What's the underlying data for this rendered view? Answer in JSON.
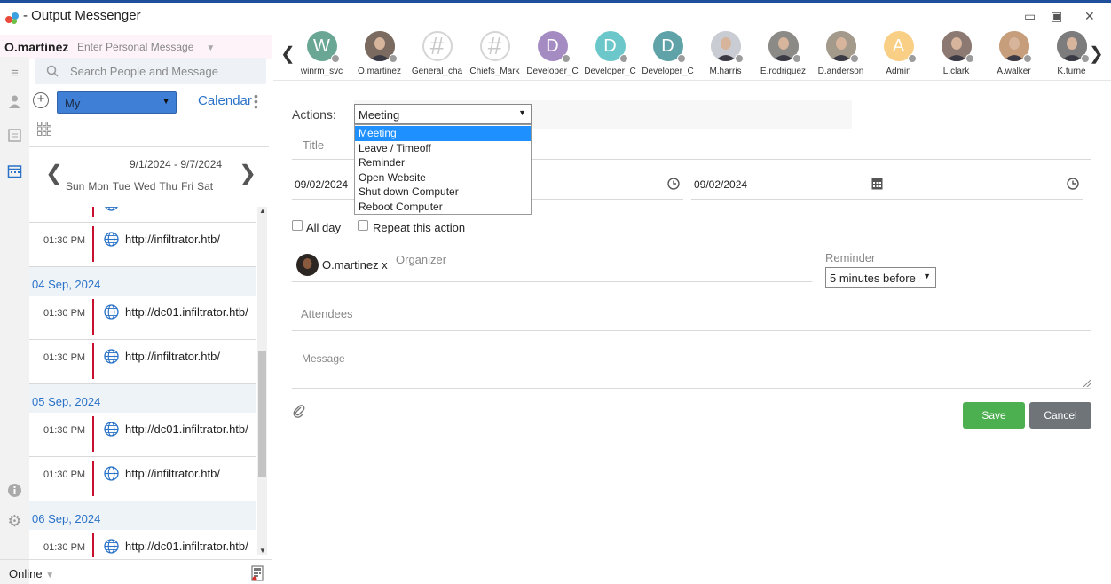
{
  "app": {
    "title": "- Output Messenger"
  },
  "user": {
    "name": "O.martinez",
    "personal_message_placeholder": "Enter Personal Message",
    "status": "Online"
  },
  "search": {
    "placeholder": "Search People and Message"
  },
  "calendar": {
    "filter": "My",
    "label": "Calendar",
    "week_range": "9/1/2024 - 9/7/2024",
    "day_names": [
      "Sun",
      "Mon",
      "Tue",
      "Wed",
      "Thu",
      "Fri",
      "Sat"
    ],
    "sections": [
      {
        "type": "event",
        "time": "",
        "url": "·"
      },
      {
        "type": "event",
        "time": "01:30 PM",
        "url": "http://infiltrator.htb/"
      },
      {
        "type": "date",
        "label": "04 Sep, 2024"
      },
      {
        "type": "event",
        "time": "01:30 PM",
        "url": "http://dc01.infiltrator.htb/"
      },
      {
        "type": "event",
        "time": "01:30 PM",
        "url": "http://infiltrator.htb/"
      },
      {
        "type": "date",
        "label": "05 Sep, 2024"
      },
      {
        "type": "event",
        "time": "01:30 PM",
        "url": "http://dc01.infiltrator.htb/"
      },
      {
        "type": "event",
        "time": "01:30 PM",
        "url": "http://infiltrator.htb/"
      },
      {
        "type": "date",
        "label": "06 Sep, 2024"
      },
      {
        "type": "event",
        "time": "01:30 PM",
        "url": "http://dc01.infiltrator.htb/"
      }
    ]
  },
  "contacts": [
    {
      "name": "winrm_svc",
      "initial": "W",
      "color": "#6aa694",
      "kind": "letter"
    },
    {
      "name": "O.martinez",
      "initial": "",
      "color": "#7a6a60",
      "kind": "photo"
    },
    {
      "name": "General_cha",
      "initial": "#",
      "color": "#eeeeee",
      "kind": "hash"
    },
    {
      "name": "Chiefs_Mark",
      "initial": "#",
      "color": "#eeeeee",
      "kind": "hash"
    },
    {
      "name": "Developer_C",
      "initial": "D",
      "color": "#a48bc2",
      "kind": "letter"
    },
    {
      "name": "Developer_C",
      "initial": "D",
      "color": "#6bc7c9",
      "kind": "letter"
    },
    {
      "name": "Developer_C",
      "initial": "D",
      "color": "#5fa3a8",
      "kind": "letter"
    },
    {
      "name": "M.harris",
      "initial": "",
      "color": "#c9cdd3",
      "kind": "photo"
    },
    {
      "name": "E.rodriguez",
      "initial": "",
      "color": "#8b8a86",
      "kind": "photo"
    },
    {
      "name": "D.anderson",
      "initial": "",
      "color": "#a49a8c",
      "kind": "photo"
    },
    {
      "name": "Admin",
      "initial": "A",
      "color": "#f8cf84",
      "kind": "letter"
    },
    {
      "name": "L.clark",
      "initial": "",
      "color": "#8c7a72",
      "kind": "photo"
    },
    {
      "name": "A.walker",
      "initial": "",
      "color": "#c79e7c",
      "kind": "photo"
    },
    {
      "name": "K.turne",
      "initial": "",
      "color": "#7c7c7c",
      "kind": "photo"
    }
  ],
  "form": {
    "actions_label": "Actions:",
    "action_selected": "Meeting",
    "action_options": [
      "Meeting",
      "Leave / Timeoff",
      "Reminder",
      "Open Website",
      "Shut down Computer",
      "Reboot Computer"
    ],
    "title_placeholder": "Title",
    "start_date": "09/02/2024",
    "end_date": "09/02/2024",
    "all_day": "All day",
    "repeat": "Repeat this action",
    "organizer_chip": "O.martinez x",
    "organizer_label": "Organizer",
    "reminder_label": "Reminder",
    "reminder_value": "5 minutes before",
    "attendees_label": "Attendees",
    "message_placeholder": "Message",
    "save": "Save",
    "cancel": "Cancel"
  },
  "colors": {
    "accent": "#2a72c7",
    "save": "#4caf50",
    "cancel": "#6f7479",
    "event_bar": "#c8102e",
    "selected_option": "#1e90ff"
  }
}
